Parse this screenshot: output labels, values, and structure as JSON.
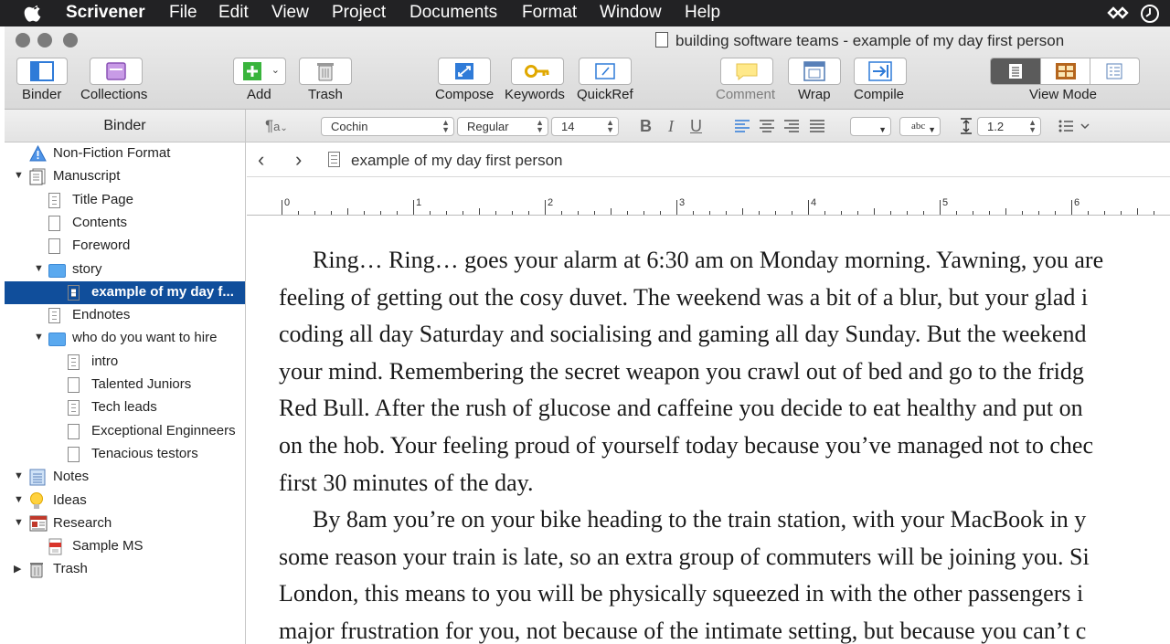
{
  "menubar": {
    "app": "Scrivener",
    "items": [
      "File",
      "Edit",
      "View",
      "Project",
      "Documents",
      "Format",
      "Window",
      "Help"
    ]
  },
  "window": {
    "title": "building software teams - example of my day first person"
  },
  "toolbar": {
    "binder": "Binder",
    "collections": "Collections",
    "add": "Add",
    "trash": "Trash",
    "compose": "Compose",
    "keywords": "Keywords",
    "quickref": "QuickRef",
    "comment": "Comment",
    "wrap": "Wrap",
    "compile": "Compile",
    "view_mode": "View Mode"
  },
  "formatbar": {
    "binder_header": "Binder",
    "font": "Cochin",
    "style": "Regular",
    "size": "14",
    "line_spacing": "1.2",
    "highlight_sample": "abc"
  },
  "binder": {
    "items": [
      {
        "label": "Non-Fiction Format",
        "level": 0,
        "icon": "warning-icon",
        "disclosure": ""
      },
      {
        "label": "Manuscript",
        "level": 0,
        "icon": "manuscript-icon",
        "disclosure": "▼"
      },
      {
        "label": "Title Page",
        "level": 1,
        "icon": "text-document-icon",
        "disclosure": ""
      },
      {
        "label": "Contents",
        "level": 1,
        "icon": "blank-document-icon",
        "disclosure": ""
      },
      {
        "label": "Foreword",
        "level": 1,
        "icon": "blank-document-icon",
        "disclosure": ""
      },
      {
        "label": "story",
        "level": 1,
        "icon": "folder-icon",
        "disclosure": "▼"
      },
      {
        "label": "example of my day f...",
        "level": 2,
        "icon": "text-document-icon",
        "disclosure": "",
        "selected": true
      },
      {
        "label": "Endnotes",
        "level": 1,
        "icon": "text-document-icon",
        "disclosure": ""
      },
      {
        "label": "who do you want to hire",
        "level": 1,
        "icon": "folder-icon",
        "disclosure": "▼"
      },
      {
        "label": "intro",
        "level": 2,
        "icon": "text-document-icon",
        "disclosure": ""
      },
      {
        "label": "Talented Juniors",
        "level": 2,
        "icon": "blank-document-icon",
        "disclosure": ""
      },
      {
        "label": "Tech leads",
        "level": 2,
        "icon": "text-document-icon",
        "disclosure": ""
      },
      {
        "label": "Exceptional Enginneers",
        "level": 2,
        "icon": "blank-document-icon",
        "disclosure": ""
      },
      {
        "label": "Tenacious testors",
        "level": 2,
        "icon": "blank-document-icon",
        "disclosure": ""
      },
      {
        "label": "Notes",
        "level": 0,
        "icon": "notes-icon",
        "disclosure": "▼"
      },
      {
        "label": "Ideas",
        "level": 0,
        "icon": "lightbulb-icon",
        "disclosure": "▼"
      },
      {
        "label": "Research",
        "level": 0,
        "icon": "research-icon",
        "disclosure": "▼"
      },
      {
        "label": "Sample MS",
        "level": 1,
        "icon": "pdf-icon",
        "disclosure": ""
      },
      {
        "label": "Trash",
        "level": 0,
        "icon": "trash-icon",
        "disclosure": "▶"
      }
    ]
  },
  "editor": {
    "doc_title": "example of my day first person",
    "ruler_numbers": [
      "0",
      "1",
      "2",
      "3",
      "4",
      "5",
      "6"
    ],
    "lines": [
      "Ring… Ring… goes your alarm at 6:30 am on Monday morning. Yawning, you are",
      "feeling of getting out the cosy duvet. The weekend was a bit of a blur, but your glad i",
      "coding all day Saturday and socialising and gaming all day Sunday. But the weekend",
      "your mind. Remembering the secret weapon you crawl out of bed and go to the fridg",
      "Red Bull. After the rush of glucose and caffeine you decide to eat healthy and put on",
      "on the hob. Your feeling proud of yourself today because you’ve managed not to chec",
      "first 30 minutes of the day.",
      "By 8am you’re on your bike heading to the train station, with your MacBook in y",
      "some reason your train is late, so an extra group of commuters will be joining you. Si",
      "London, this means to you will be physically squeezed in with the other passengers i",
      "major frustration for you, not because of the intimate setting, but because you can’t c"
    ]
  }
}
